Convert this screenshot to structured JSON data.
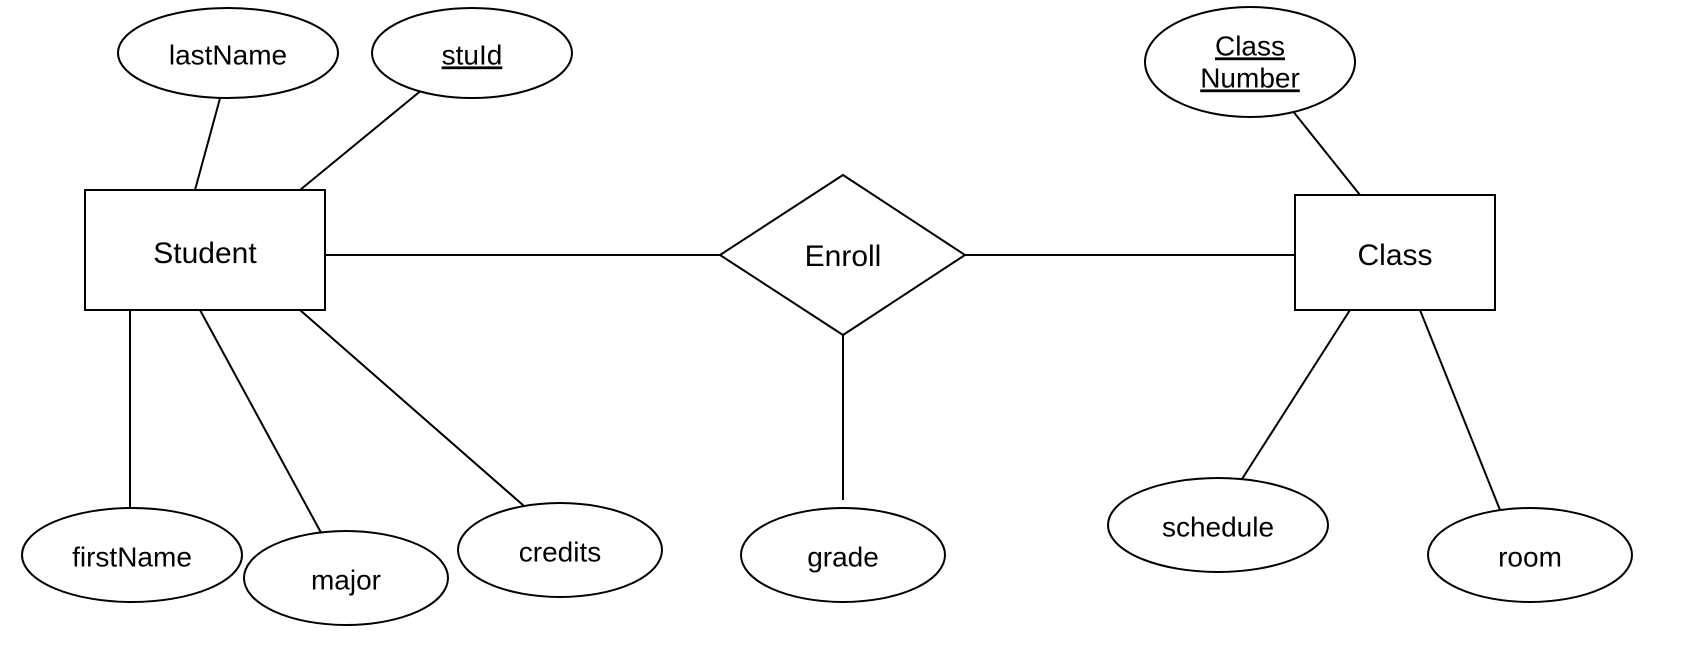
{
  "entities": {
    "student": {
      "label": "Student"
    },
    "class": {
      "label": "Class"
    }
  },
  "relationship": {
    "enroll": {
      "label": "Enroll"
    }
  },
  "attributes": {
    "lastName": {
      "label": "lastName",
      "key": false
    },
    "stuId": {
      "label": "stuId",
      "key": true
    },
    "firstName": {
      "label": "firstName",
      "key": false
    },
    "major": {
      "label": "major",
      "key": false
    },
    "credits": {
      "label": "credits",
      "key": false
    },
    "grade": {
      "label": "grade",
      "key": false
    },
    "classNumber": {
      "label_line1": "Class",
      "label_line2": "Number",
      "key": true
    },
    "schedule": {
      "label": "schedule",
      "key": false
    },
    "room": {
      "label": "room",
      "key": false
    }
  }
}
